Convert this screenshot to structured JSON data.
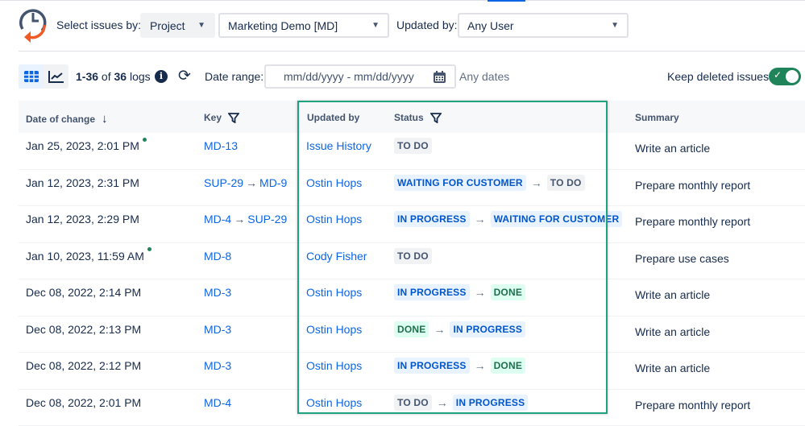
{
  "filters": {
    "select_by_label": "Select issues by:",
    "select_by_value": "Project",
    "project_value": "Marketing Demo [MD]",
    "updated_by_label": "Updated by:",
    "updated_by_value": "Any User"
  },
  "toolbar": {
    "range_start": "1-36",
    "of": "of",
    "total": "36",
    "logs": "logs",
    "date_range_label": "Date range:",
    "date_placeholder": "mm/dd/yyyy - mm/dd/yyyy",
    "any_dates": "Any dates",
    "keep_deleted_label": "Keep deleted issues",
    "keep_deleted_on": true
  },
  "columns": {
    "date": "Date of change",
    "key": "Key",
    "updated_by": "Updated by",
    "status": "Status",
    "summary": "Summary"
  },
  "rows": [
    {
      "date": "Jan 25, 2023, 2:01 PM",
      "dot": true,
      "key_from": "MD-13",
      "key_to": null,
      "user": "Issue History",
      "status_from": {
        "label": "TO DO",
        "kind": "todo"
      },
      "status_to": null,
      "summary": "Write an article"
    },
    {
      "date": "Jan 12, 2023, 2:31 PM",
      "dot": false,
      "key_from": "SUP-29",
      "key_to": "MD-9",
      "user": "Ostin Hops",
      "status_from": {
        "label": "WAITING FOR CUSTOMER",
        "kind": "blue"
      },
      "status_to": {
        "label": "TO DO",
        "kind": "todo"
      },
      "summary": "Prepare monthly report"
    },
    {
      "date": "Jan 12, 2023, 2:29 PM",
      "dot": false,
      "key_from": "MD-4",
      "key_to": "SUP-29",
      "user": "Ostin Hops",
      "status_from": {
        "label": "IN PROGRESS",
        "kind": "blue"
      },
      "status_to": {
        "label": "WAITING FOR CUSTOMER",
        "kind": "blue"
      },
      "summary": "Prepare monthly report"
    },
    {
      "date": "Jan 10, 2023, 11:59 AM",
      "dot": true,
      "key_from": "MD-8",
      "key_to": null,
      "user": "Cody Fisher",
      "status_from": {
        "label": "TO DO",
        "kind": "todo"
      },
      "status_to": null,
      "summary": "Prepare use cases"
    },
    {
      "date": "Dec 08, 2022, 2:14 PM",
      "dot": false,
      "key_from": "MD-3",
      "key_to": null,
      "user": "Ostin Hops",
      "status_from": {
        "label": "IN PROGRESS",
        "kind": "blue"
      },
      "status_to": {
        "label": "DONE",
        "kind": "done"
      },
      "summary": "Write an article"
    },
    {
      "date": "Dec 08, 2022, 2:13 PM",
      "dot": false,
      "key_from": "MD-3",
      "key_to": null,
      "user": "Ostin Hops",
      "status_from": {
        "label": "DONE",
        "kind": "done"
      },
      "status_to": {
        "label": "IN PROGRESS",
        "kind": "blue"
      },
      "summary": "Write an article"
    },
    {
      "date": "Dec 08, 2022, 2:12 PM",
      "dot": false,
      "key_from": "MD-3",
      "key_to": null,
      "user": "Ostin Hops",
      "status_from": {
        "label": "IN PROGRESS",
        "kind": "blue"
      },
      "status_to": {
        "label": "DONE",
        "kind": "done"
      },
      "summary": "Write an article"
    },
    {
      "date": "Dec 08, 2022, 2:01 PM",
      "dot": false,
      "key_from": "MD-4",
      "key_to": null,
      "user": "Ostin Hops",
      "status_from": {
        "label": "TO DO",
        "kind": "todo"
      },
      "status_to": {
        "label": "IN PROGRESS",
        "kind": "blue"
      },
      "summary": "Prepare monthly report"
    }
  ]
}
